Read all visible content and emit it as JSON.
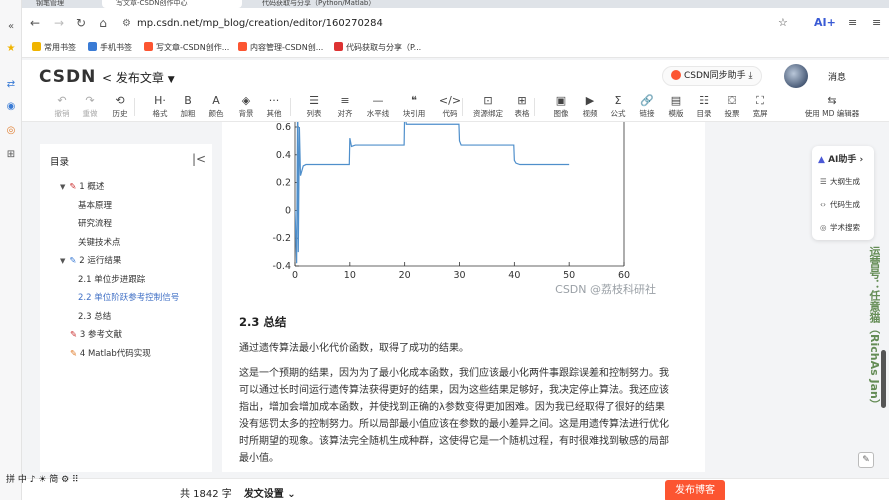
{
  "browser": {
    "tabs": [
      {
        "title": "钢笔管理"
      },
      {
        "title": "写文章-CSDN创作中心"
      },
      {
        "title": "代码获取与分享（Python/Matlab）"
      }
    ],
    "url": "mp.csdn.net/mp_blog/creation/editor/160270284",
    "bookmarks": [
      "常用书签",
      "手机书签",
      "写文章-CSDN创作...",
      "内容管理-CSDN创...",
      "代码获取与分享（P..."
    ],
    "ai_label": "AI+",
    "icons": [
      "back-icon",
      "forward-icon",
      "reload-icon",
      "home-icon",
      "star-icon",
      "menu-icon"
    ]
  },
  "header": {
    "logo": "CSDN",
    "back_glyph": "<",
    "page_title": "发布文章",
    "helper": "CSDN同步助手",
    "messages": "消息"
  },
  "toolbar": {
    "items": [
      {
        "label": "撤销",
        "glyph": "↶",
        "disabled": true
      },
      {
        "label": "重做",
        "glyph": "↷",
        "disabled": true
      },
      {
        "label": "历史",
        "glyph": "⟲"
      },
      {
        "label": "格式",
        "glyph": "H·"
      },
      {
        "label": "加粗",
        "glyph": "B"
      },
      {
        "label": "颜色",
        "glyph": "A"
      },
      {
        "label": "背景",
        "glyph": "◈"
      },
      {
        "label": "其他",
        "glyph": "···"
      },
      {
        "label": "列表",
        "glyph": "☰"
      },
      {
        "label": "对齐",
        "glyph": "≡"
      },
      {
        "label": "水平线",
        "glyph": "—"
      },
      {
        "label": "块引用",
        "glyph": "❝"
      },
      {
        "label": "代码",
        "glyph": "</>"
      },
      {
        "label": "资源绑定",
        "glyph": "⊡"
      },
      {
        "label": "表格",
        "glyph": "⊞"
      },
      {
        "label": "图像",
        "glyph": "▣"
      },
      {
        "label": "视频",
        "glyph": "▶"
      },
      {
        "label": "公式",
        "glyph": "Σ"
      },
      {
        "label": "链接",
        "glyph": "🔗"
      },
      {
        "label": "模版",
        "glyph": "▤"
      },
      {
        "label": "目录",
        "glyph": "☷"
      },
      {
        "label": "投票",
        "glyph": "⛋"
      },
      {
        "label": "宽屏",
        "glyph": "⛶"
      },
      {
        "label": "使用 MD 编辑器",
        "glyph": "⇆"
      }
    ]
  },
  "toc": {
    "title": "目录",
    "items": [
      {
        "label": "1 概述",
        "level": 1
      },
      {
        "label": "基本原理",
        "level": 2
      },
      {
        "label": "研究流程",
        "level": 2
      },
      {
        "label": "关键技术点",
        "level": 2
      },
      {
        "label": "2 运行结果",
        "level": 1
      },
      {
        "label": "2.1 单位步进跟踪",
        "level": 2
      },
      {
        "label": "2.2 单位阶跃参考控制信号",
        "level": 2,
        "active": true
      },
      {
        "label": "2.3 总结",
        "level": 2
      },
      {
        "label": "3 参考文献",
        "level": 1
      },
      {
        "label": "4 Matlab代码实现",
        "level": 1
      }
    ]
  },
  "editor": {
    "heading": "2.3 总结",
    "para1": "通过遗传算法最小化代价函数，取得了成功的结果。",
    "para2_lines": [
      "这是一个预期的结果，因为为了最小化成本函数，我们应该最小化两件事跟踪误差和控制努力。我",
      "可以通过长时间运行遗传算法获得更好的结果，因为这些结果足够好，我决定停止算法。我还应该",
      "指出，增加会增加成本函数，并使找到正确的λ参数变得更加困难。因为我已经取得了很好的结果",
      "没有惩罚太多的控制努力。所以局部最小值应该在参数的最小差异之间。这是用遗传算法进行优化",
      "时所期望的现象。该算法完全随机生成种群，这使得它是一个随机过程，有时很难找到敏感的局部",
      "最小值。"
    ],
    "watermark": "CSDN @荔枝科研社"
  },
  "chart_data": {
    "type": "line",
    "x_ticks": [
      0,
      10,
      20,
      30,
      40,
      50,
      60
    ],
    "y_ticks": [
      0.6,
      0.4,
      0.2,
      0,
      -0.2,
      -0.4
    ],
    "xlim": [
      0,
      60
    ],
    "ylim": [
      -0.4,
      0.6
    ],
    "series": [
      {
        "color": "#4f8fcb",
        "x": [
          0,
          0.3,
          0.5,
          0.6,
          0.8,
          1,
          1.5,
          2,
          3,
          9.9,
          10,
          10.3,
          11,
          19.9,
          20,
          20.3,
          21,
          29.9,
          30,
          30.3,
          31,
          39.9,
          40,
          40.3,
          41,
          50
        ],
        "y": [
          0.0,
          -0.38,
          0.9,
          -0.3,
          0.6,
          0.25,
          0.32,
          0.33,
          0.33,
          0.33,
          0.52,
          0.46,
          0.47,
          0.47,
          0.72,
          0.62,
          0.62,
          0.62,
          0.5,
          0.47,
          0.47,
          0.47,
          0.36,
          0.34,
          0.33,
          0.33
        ]
      }
    ]
  },
  "ai_panel": {
    "title": "AI助手",
    "items": [
      "大纲生成",
      "代码生成",
      "学术搜索"
    ]
  },
  "side_watermark": "运营号：任意猫（RichAs Jan）",
  "bottom": {
    "word_count": "共 1842 字",
    "settings": "发文设置",
    "publish": "发布博客",
    "ime": "拼 中 ♪ ☀ 简 ⚙ ⠿"
  }
}
